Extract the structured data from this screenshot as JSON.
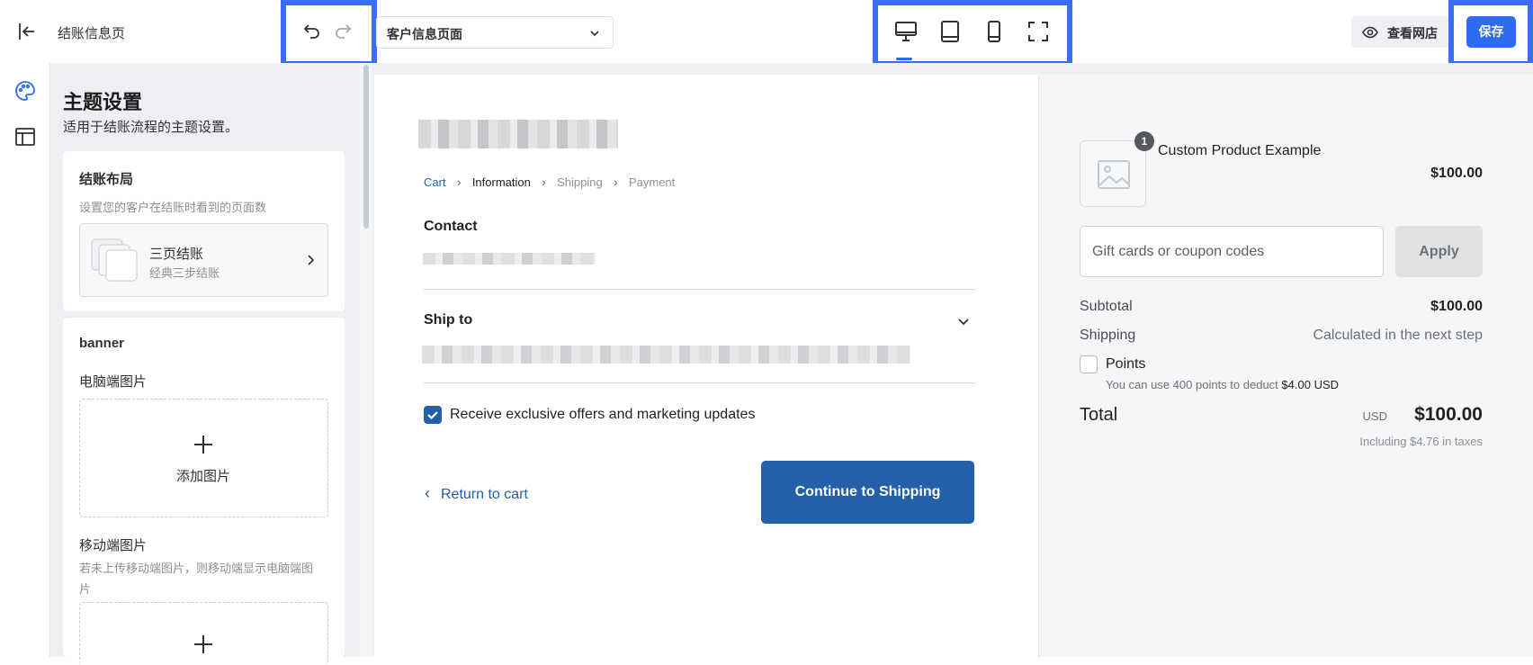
{
  "topbar": {
    "page_name": "结账信息页",
    "page_select_value": "客户信息页面",
    "view_store_label": "查看网店",
    "save_label": "保存",
    "highlight_color": "#3b6cf6"
  },
  "settings": {
    "title": "主题设置",
    "subtitle": "适用于结账流程的主题设置。",
    "layout_card": {
      "title": "结账布局",
      "desc": "设置您的客户在结账时看到的页面数",
      "option_title": "三页结账",
      "option_sub": "经典三步结账"
    },
    "banner_card": {
      "title": "banner",
      "desktop_label": "电脑端图片",
      "add_image": "添加图片",
      "mobile_label": "移动端图片",
      "mobile_desc": "若未上传移动端图片，则移动端显示电脑端图片"
    }
  },
  "checkout": {
    "breadcrumbs": [
      "Cart",
      "Information",
      "Shipping",
      "Payment"
    ],
    "contact_heading": "Contact",
    "ship_to_heading": "Ship to",
    "marketing_label": "Receive exclusive offers and marketing updates",
    "return_label": "Return to cart",
    "continue_label": "Continue to Shipping",
    "accent": "#2360a8"
  },
  "summary": {
    "product_name": "Custom Product Example",
    "product_qty": "1",
    "product_price": "$100.00",
    "coupon_placeholder": "Gift cards or coupon codes",
    "apply_label": "Apply",
    "subtotal_label": "Subtotal",
    "subtotal_value": "$100.00",
    "shipping_label": "Shipping",
    "shipping_value": "Calculated in the next step",
    "points_label": "Points",
    "points_note": "You can use 400 points to deduct",
    "points_deduct": "$4.00 USD",
    "total_label": "Total",
    "total_currency": "USD",
    "total_value": "$100.00",
    "taxes_note": "Including $4.76 in taxes"
  }
}
